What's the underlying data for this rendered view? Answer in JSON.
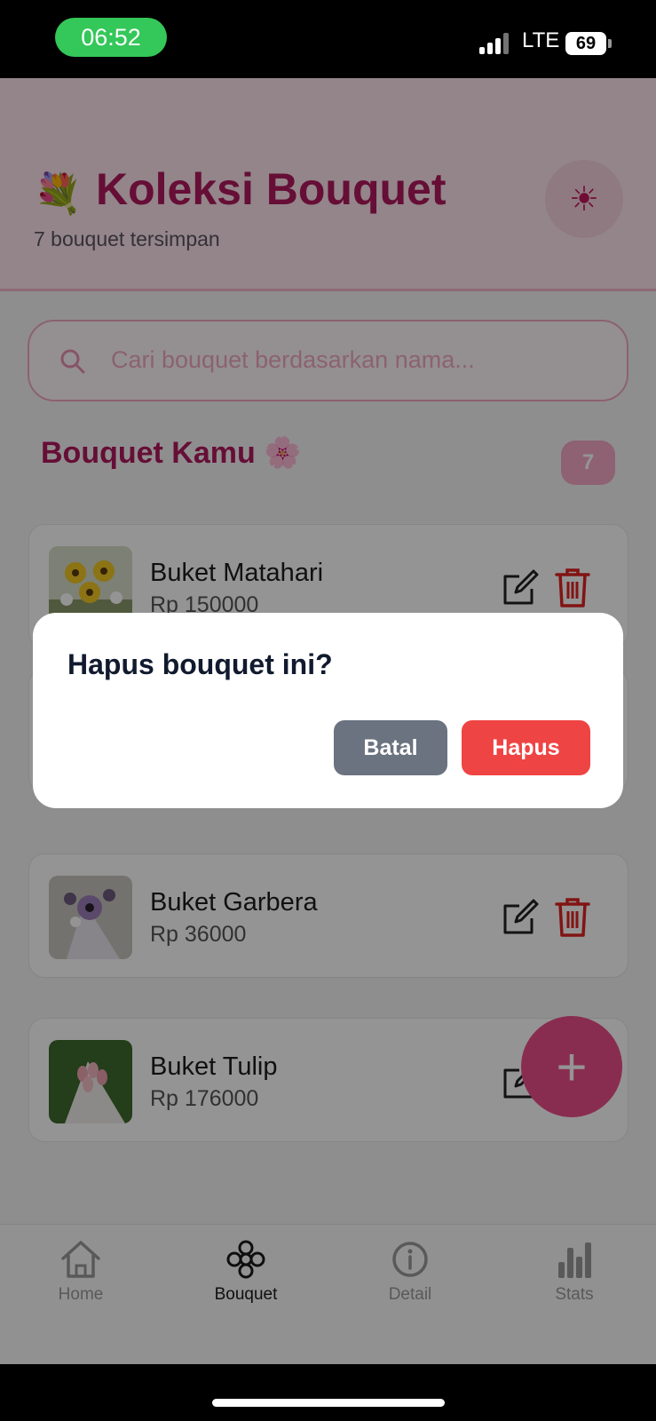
{
  "status_bar": {
    "time": "06:52",
    "network": "LTE",
    "battery": "69"
  },
  "header": {
    "emoji": "💐",
    "title": "Koleksi Bouquet",
    "subtitle": "7 bouquet tersimpan",
    "theme_icon": "☀"
  },
  "search": {
    "placeholder": "Cari bouquet berdasarkan nama..."
  },
  "section": {
    "title": "Bouquet Kamu 🌸",
    "count": "7"
  },
  "bouquets": [
    {
      "name": "Buket Matahari",
      "price": "Rp 150000"
    },
    {
      "name": "Buket Garbera",
      "price": "Rp 36000"
    },
    {
      "name": "Buket Tulip",
      "price": "Rp 176000"
    }
  ],
  "fab": {
    "icon": "+"
  },
  "bottom_nav": [
    {
      "label": "Home",
      "icon": "home-icon"
    },
    {
      "label": "Bouquet",
      "icon": "flower-icon",
      "active": true
    },
    {
      "label": "Detail",
      "icon": "info-icon"
    },
    {
      "label": "Stats",
      "icon": "bar-chart-icon"
    }
  ],
  "dialog": {
    "title": "Hapus bouquet ini?",
    "cancel_label": "Batal",
    "confirm_label": "Hapus"
  },
  "colors": {
    "brand": "#b0195d",
    "accent": "#ec4f8b",
    "danger": "#ef4444",
    "muted_button": "#6b7280"
  }
}
